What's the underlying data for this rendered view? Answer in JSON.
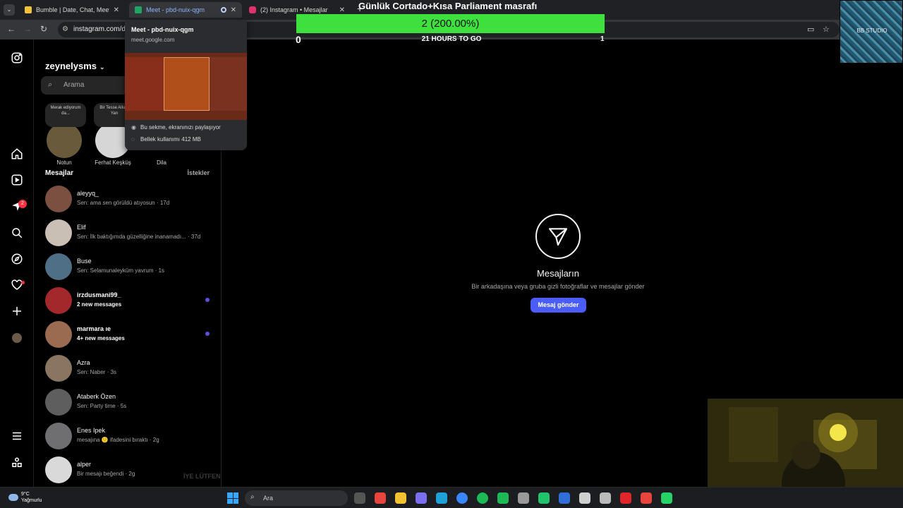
{
  "browser": {
    "tabs": [
      {
        "title": "Bumble | Date, Chat, Meet New",
        "color": "#f6c23a"
      },
      {
        "title": "Meet - pbd-nuix-qgm",
        "color": "#1fa463"
      },
      {
        "title": "(2) Instagram • Mesajlar",
        "color": "#e1306c"
      }
    ],
    "url": "instagram.com/di",
    "hovercard": {
      "title": "Meet - pbd-nuix-qgm",
      "url": "meet.google.com",
      "sharing": "Bu sekme, ekranınızı paylaşıyor",
      "memory": "Bellek kullanımı 412 MB"
    }
  },
  "goal": {
    "title": "Günlük Cortado+Kısa Parliament masrafı",
    "progress_text": "2 (200.00%)",
    "progress_fraction": 1.0,
    "min": "0",
    "hours": "21 HOURS TO GO",
    "max": "1",
    "bar_color": "#3ee03e"
  },
  "overlay": {
    "studio_label": "BB STUDIO"
  },
  "rail": {
    "badge": "2"
  },
  "dm": {
    "username": "zeynelysms",
    "search_placeholder": "Arama",
    "notes": [
      {
        "bubble": "Merak ediyorum da...",
        "name": "Notun"
      },
      {
        "bubble": "Bir Tesse Allure Yan",
        "name": "Ferhat Keşküş"
      },
      {
        "bubble": "",
        "name": "Dila"
      }
    ],
    "section_title": "Mesajlar",
    "requests": "İstekler",
    "conversations": [
      {
        "name": "aleyyq_",
        "preview": "Sen: ama sen görüldü atıyosun · 17d",
        "unread": false,
        "color": "#7a5040"
      },
      {
        "name": "Elif",
        "preview": "Sen: İlk baktığımda güzelliğine inanamadı... · 37d",
        "unread": false,
        "color": "#c9bfb4"
      },
      {
        "name": "Buse",
        "preview": "Sen: Selamunaleyküm yavrum · 1s",
        "unread": false,
        "color": "#4f6f86"
      },
      {
        "name": "irzdusmani99_",
        "preview": "2 new messages",
        "unread": true,
        "color": "#a3282b"
      },
      {
        "name": "marmara ıe",
        "preview": "4+ new messages",
        "unread": true,
        "color": "#9a6b50"
      },
      {
        "name": "Azra",
        "preview": "Sen: Naber · 3s",
        "unread": false,
        "color": "#8a7560"
      },
      {
        "name": "Ataberk Özen",
        "preview": "Sen: Party time · 5s",
        "unread": false,
        "color": "#5e5e5e"
      },
      {
        "name": "Enes Ipek",
        "preview": "mesajına 🙂 ifadesini bıraktı · 2g",
        "unread": false,
        "color": "#6f6f72"
      },
      {
        "name": "alper",
        "preview": "Bir mesajı beğendi · 2g",
        "unread": false,
        "color": "#d9d9d9"
      }
    ],
    "ghost_text": "İYE LÜTFEN"
  },
  "main": {
    "title": "Mesajların",
    "subtitle": "Bir arkadaşına veya gruba gizli fotoğraflar ve mesajlar gönder",
    "button": "Mesaj gönder"
  },
  "taskbar": {
    "temp": "9°C",
    "weather": "Yağmurlu",
    "search": "Ara",
    "apps": [
      "file-explorer",
      "chrome",
      "folder",
      "copilot",
      "edge",
      "store",
      "spotify",
      "spotify-2",
      "settings",
      "app-green",
      "photos",
      "network",
      "obs",
      "opera",
      "chrome-2",
      "whatsapp"
    ]
  }
}
